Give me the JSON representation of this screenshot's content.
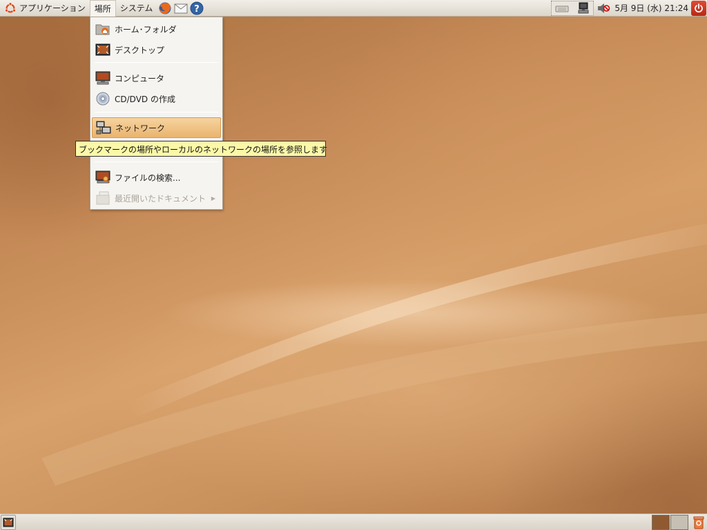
{
  "top_panel": {
    "menus": [
      {
        "label": "アプリケーション"
      },
      {
        "label": "場所"
      },
      {
        "label": "システム"
      }
    ],
    "clock": "5月 9日 (水) 21:24"
  },
  "places_menu": {
    "items": [
      {
        "label": "ホーム･フォルダ",
        "icon": "home-folder-icon"
      },
      {
        "label": "デスクトップ",
        "icon": "desktop-icon"
      },
      {
        "label": "コンピュータ",
        "icon": "computer-icon"
      },
      {
        "label": "CD/DVD の作成",
        "icon": "cd-dvd-icon"
      },
      {
        "label": "ネットワーク",
        "icon": "network-icon"
      },
      {
        "label": "ファイルの検索...",
        "icon": "search-files-icon"
      },
      {
        "label": "最近開いたドキュメント",
        "icon": "recent-documents-icon"
      }
    ]
  },
  "tooltip": {
    "text": "ブックマークの場所やローカルのネットワークの場所を参照します"
  },
  "colors": {
    "accent": "#eab46e",
    "panel": "#e6e1d8",
    "wallpaper": "#c08552"
  }
}
